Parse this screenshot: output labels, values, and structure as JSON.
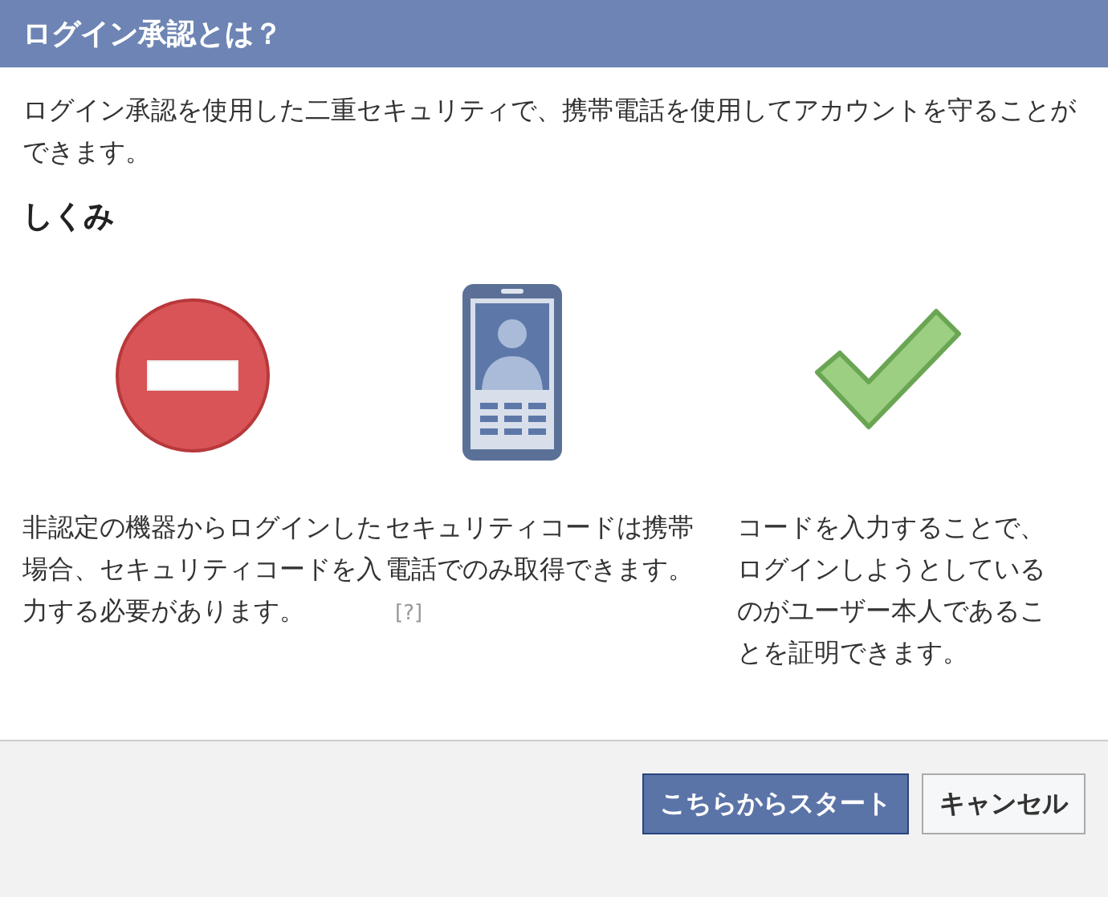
{
  "dialog": {
    "title": "ログイン承認とは？"
  },
  "intro": "ログイン承認を使用した二重セキュリティで、携帯電話を使用してアカウントを守ることができます。",
  "section_heading": "しくみ",
  "steps": [
    {
      "kind": "blocked",
      "text": "非認定の機器からログインした場合、セキュリティコードを入力する必要があります。"
    },
    {
      "kind": "phone",
      "text": "セキュリティコードは携帯電話でのみ取得できます。",
      "help_link": "[?]"
    },
    {
      "kind": "check",
      "text": "コードを入力することで、ログインしようとしているのがユーザー本人であることを証明できます。"
    }
  ],
  "buttons": [
    {
      "label": "こちらからスタート",
      "kind": "primary"
    },
    {
      "label": "キャンセル",
      "kind": "secondary"
    }
  ]
}
